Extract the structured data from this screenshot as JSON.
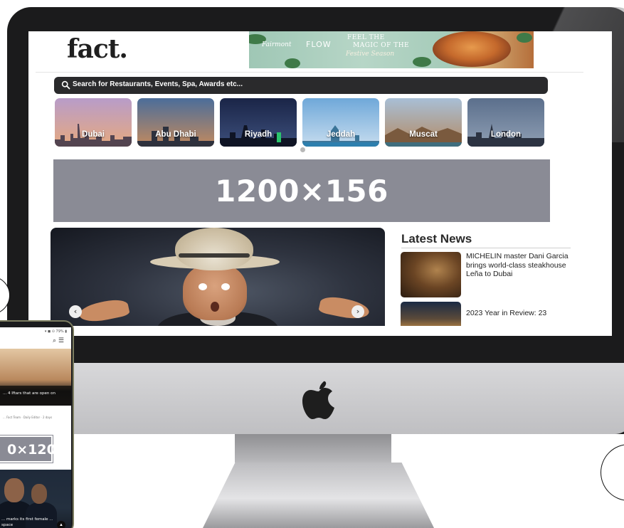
{
  "desktop_site": {
    "logo": "fact.",
    "top_ad": {
      "brand": "Fairmont",
      "partner": "FLOW",
      "line1": "FEEL THE",
      "line2": "MAGIC OF THE",
      "line3": "Festive Season"
    },
    "search": {
      "placeholder": "Search for Restaurants, Events, Spa, Awards etc..."
    },
    "cities": [
      {
        "label": "Dubai",
        "sky_top": "#b89cc9",
        "sky_bottom": "#e6a97f"
      },
      {
        "label": "Abu Dhabi",
        "sky_top": "#4b6d9a",
        "sky_bottom": "#c38a5e"
      },
      {
        "label": "Riyadh",
        "sky_top": "#1a2547",
        "sky_bottom": "#3d4f7c"
      },
      {
        "label": "Jeddah",
        "sky_top": "#6fa8d9",
        "sky_bottom": "#c7ddef"
      },
      {
        "label": "Muscat",
        "sky_top": "#a8bfd6",
        "sky_bottom": "#b48a63"
      },
      {
        "label": "London",
        "sky_top": "#5b6f8c",
        "sky_bottom": "#8f9fb4"
      }
    ],
    "banner": {
      "text": "1200×156",
      "color": "#8a8b95"
    },
    "hero": {
      "prev_icon": "chevron-left-icon",
      "next_icon": "chevron-right-icon"
    },
    "latest_news": {
      "title": "Latest News",
      "items": [
        {
          "headline": "MICHELIN master Dani Garcia brings world-class steakhouse Leña to Dubai"
        },
        {
          "headline": "2023 Year in Review: 23"
        }
      ]
    }
  },
  "mobile_site": {
    "status_text": "▾ ◼ ⊙ 79% ▮",
    "header_icons": "⌕ ☰",
    "hero_title": "... 4 Iftars that are open on",
    "byline": "... Fact Team · Daily Editor · 2 days",
    "banner": {
      "text": "0×120"
    },
    "card_title": "... marks its first female ... space"
  },
  "colors": {
    "bezel": "#1b1b1c",
    "chin": "#d1d1d3",
    "search_bar": "#2a2a2c",
    "banner": "#8a8b95"
  }
}
